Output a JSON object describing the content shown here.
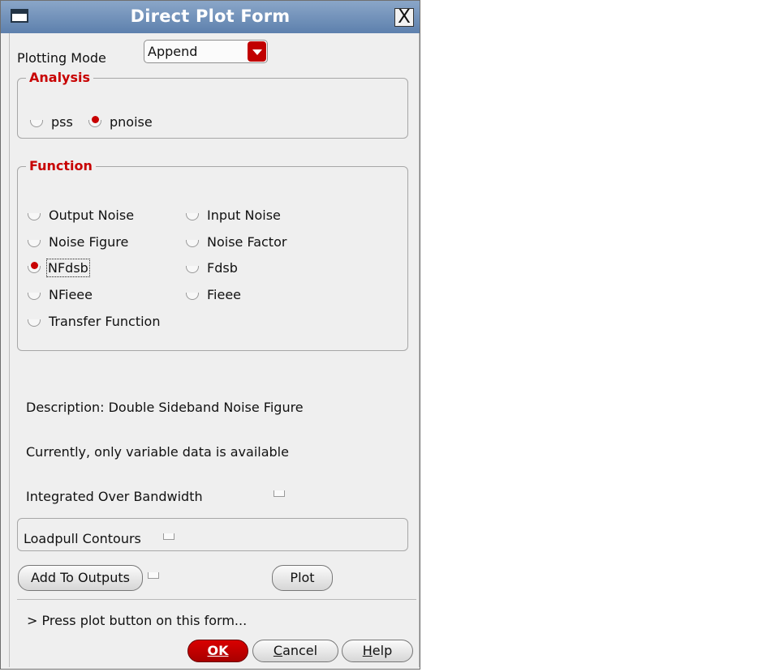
{
  "window": {
    "title": "Direct Plot Form",
    "close_glyph": "X"
  },
  "plotting_mode": {
    "label": "Plotting Mode",
    "selected": "Append"
  },
  "analysis": {
    "title": "Analysis",
    "options": [
      {
        "label": "pss",
        "selected": false
      },
      {
        "label": "pnoise",
        "selected": true
      }
    ]
  },
  "function": {
    "title": "Function",
    "options": [
      {
        "label": "Output Noise",
        "selected": false
      },
      {
        "label": "Input Noise",
        "selected": false
      },
      {
        "label": "Noise Figure",
        "selected": false
      },
      {
        "label": "Noise Factor",
        "selected": false
      },
      {
        "label": "NFdsb",
        "selected": true
      },
      {
        "label": "Fdsb",
        "selected": false
      },
      {
        "label": "NFieee",
        "selected": false
      },
      {
        "label": "Fieee",
        "selected": false
      },
      {
        "label": "Transfer Function",
        "selected": false
      }
    ]
  },
  "description": "Description: Double Sideband Noise Figure",
  "availability_note": "Currently, only variable data is available",
  "integrated_over_bandwidth": {
    "label": "Integrated Over Bandwidth",
    "checked": false
  },
  "loadpull_contours": {
    "label": "Loadpull Contours",
    "checked": false
  },
  "add_to_outputs": {
    "label": "Add To Outputs",
    "checked": false
  },
  "plot_button": "Plot",
  "status_message": "> Press plot button on this form...",
  "buttons": {
    "ok": "OK",
    "cancel_mnemonic": "C",
    "cancel_rest": "ancel",
    "help_mnemonic": "H",
    "help_rest": "elp"
  },
  "colors": {
    "accent_red": "#c80000",
    "title_bar": "#6f8fb8",
    "dialog_bg": "#efefef"
  },
  "icons": [
    "window-menu-icon",
    "close-icon",
    "dropdown-arrow-icon"
  ]
}
